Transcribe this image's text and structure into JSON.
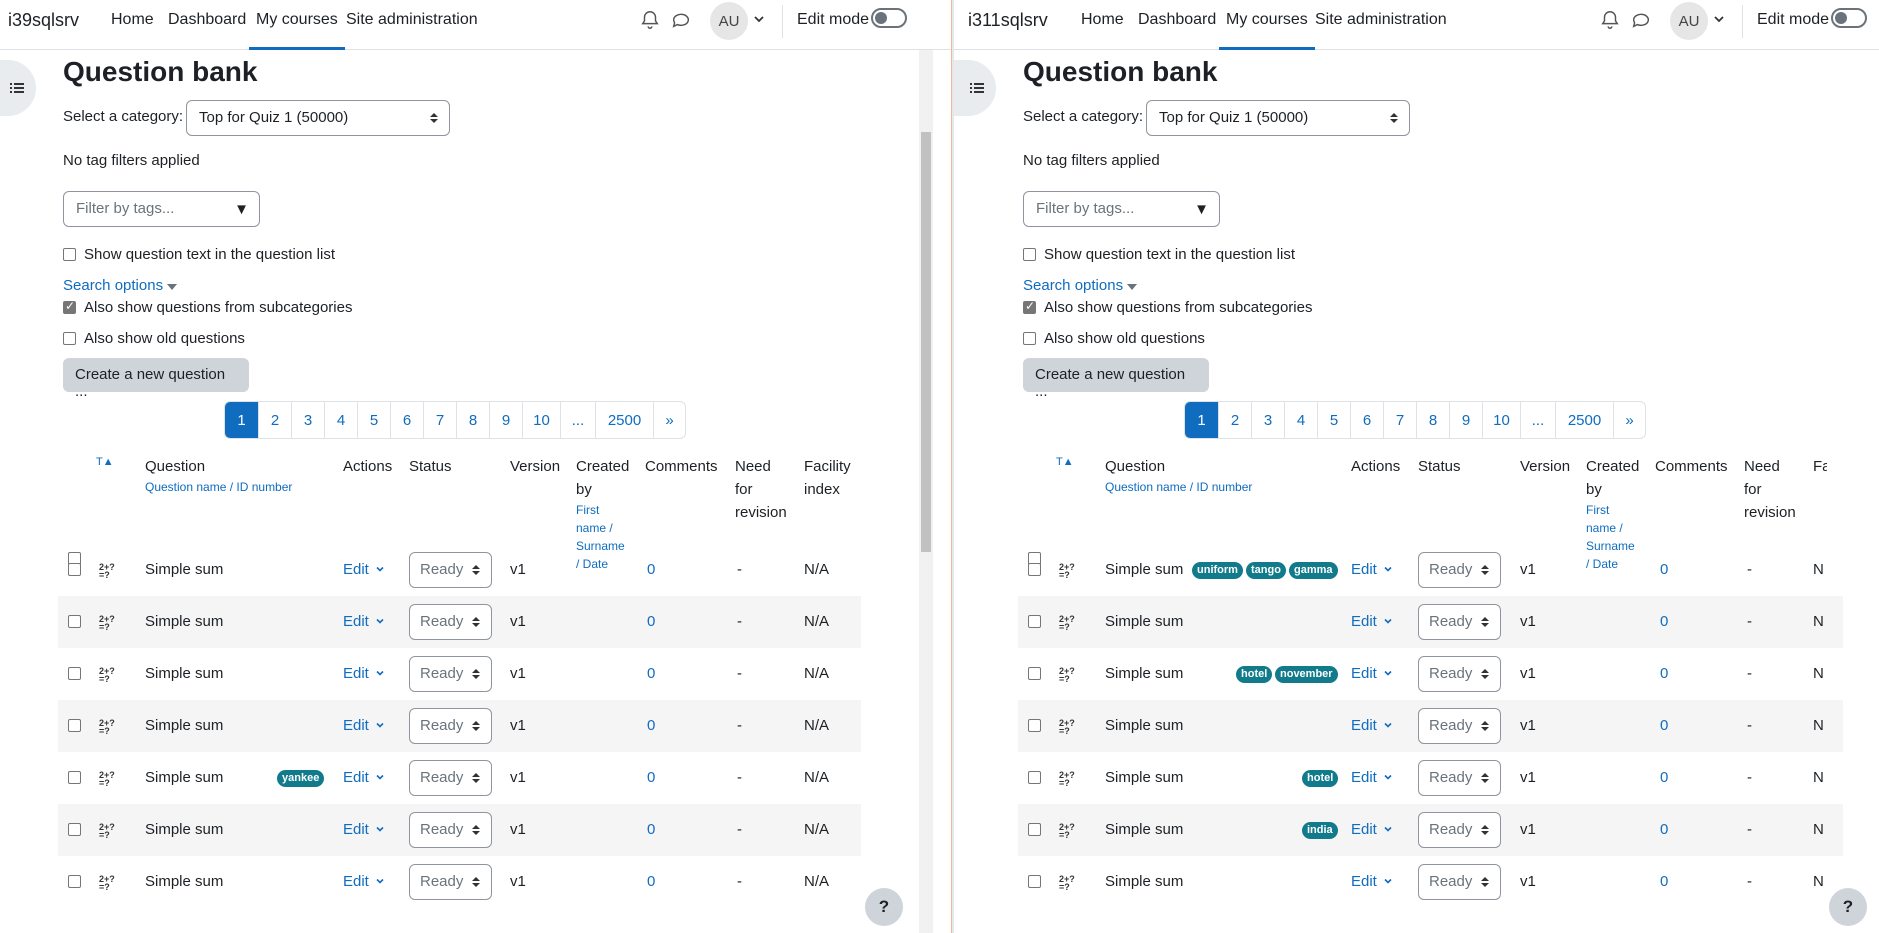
{
  "nav": {
    "left_site": "i39sqlsrv",
    "right_site": "i311sqlsrv",
    "items": [
      "Home",
      "Dashboard",
      "My courses",
      "Site administration"
    ],
    "avatar": "AU",
    "edit_mode": "Edit mode"
  },
  "page": {
    "title": "Question bank",
    "category_label": "Select a category:",
    "category_value": "Top for Quiz 1 (50000)",
    "no_tags": "No tag filters applied",
    "filter_placeholder": "Filter by tags...",
    "show_text": "Show question text in the question list",
    "search_options": "Search options",
    "subcats": "Also show questions from subcategories",
    "old": "Also show old questions",
    "create": "Create a new question ..."
  },
  "pager": [
    "1",
    "2",
    "3",
    "4",
    "5",
    "6",
    "7",
    "8",
    "9",
    "10",
    "...",
    "2500",
    "»"
  ],
  "headers": {
    "t": "T",
    "question": "Question",
    "question_sub": "Question name / ID number",
    "actions": "Actions",
    "status": "Status",
    "version": "Version",
    "created": "Created by",
    "created_sub": "First name / Surname / Date",
    "comments": "Comments",
    "revision": "Need for revision",
    "facility": "Facility index",
    "facility_cut": "Fa in"
  },
  "row": {
    "name": "Simple sum",
    "edit": "Edit",
    "status": "Ready",
    "version": "v1",
    "comments": "0",
    "revision": "-",
    "facility": "N/A",
    "facility_cut": "N"
  },
  "left_tags": [
    [],
    [],
    [],
    [],
    [
      "yankee"
    ],
    [],
    []
  ],
  "right_tags": [
    [
      "uniform",
      "tango",
      "gamma"
    ],
    [],
    [
      "hotel",
      "november"
    ],
    [],
    [
      "hotel"
    ],
    [
      "india"
    ],
    []
  ],
  "help": "?"
}
